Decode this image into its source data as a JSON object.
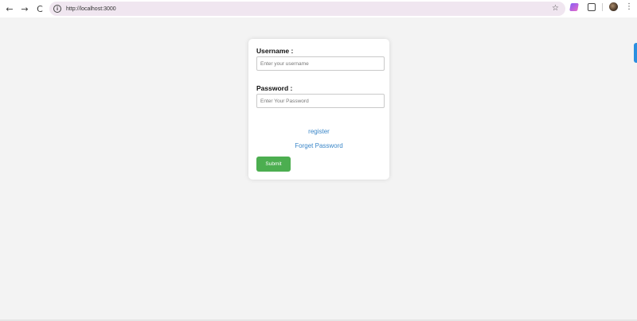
{
  "browser": {
    "url": "http://localhost:3000",
    "back_icon": "←",
    "forward_icon": "→",
    "reload_icon": "C",
    "site_info_icon": "i",
    "star_icon": "☆",
    "menu_icon": "⋮"
  },
  "form": {
    "username_label": "Username :",
    "username_placeholder": "Enter your username",
    "password_label": "Password :",
    "password_placeholder": "Enter Your Password",
    "register_link": "register",
    "forget_link": "Forget Password",
    "submit_label": "Submit"
  },
  "colors": {
    "page_background": "#f3f3f3",
    "link": "#3a86c8",
    "submit": "#4cae50",
    "side_tab": "#2a8fe0"
  }
}
